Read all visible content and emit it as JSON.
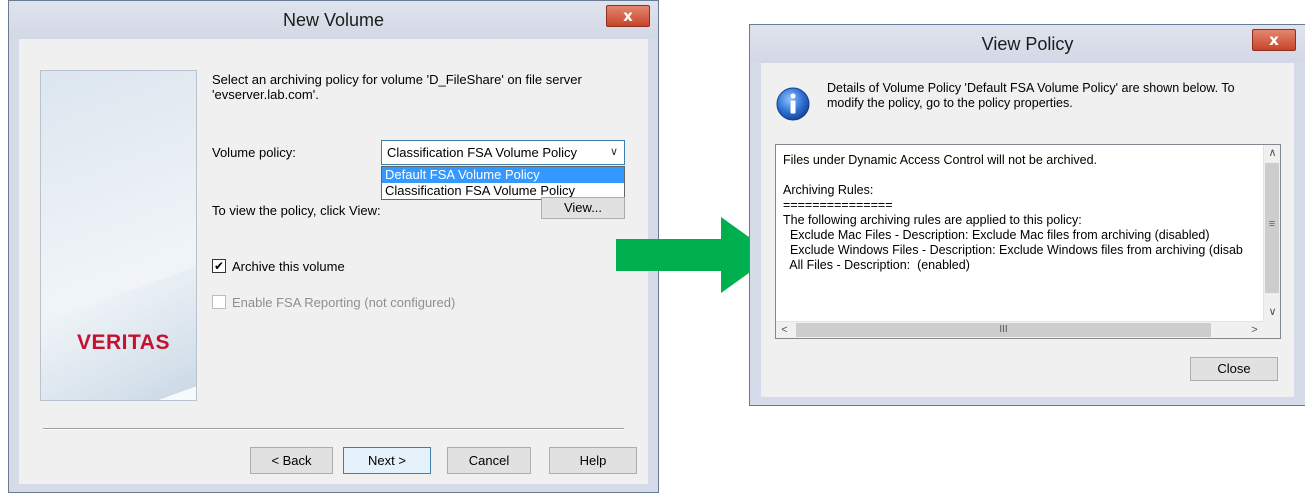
{
  "new_volume": {
    "title": "New Volume",
    "close_label": "x",
    "brand": "VERITAS",
    "intro_line1": "Select an archiving policy for volume 'D_FileShare' on file server",
    "intro_line2": "'evserver.lab.com'.",
    "volume_policy_label": "Volume policy:",
    "volume_policy_value": "Classification FSA Volume Policy",
    "dropdown_options": [
      "Default FSA Volume Policy",
      "Classification FSA Volume Policy"
    ],
    "view_hint": "To view the policy, click View:",
    "view_button": "View...",
    "archive_checkbox_label": "Archive this volume",
    "archive_checked": true,
    "reporting_checkbox_label": "Enable FSA Reporting (not configured)",
    "buttons": {
      "back": "< Back",
      "next": "Next >",
      "cancel": "Cancel",
      "help": "Help"
    }
  },
  "arrow_color": "#00b04f",
  "view_policy": {
    "title": "View Policy",
    "close_label": "x",
    "info_line1": "Details of Volume Policy 'Default FSA Volume Policy' are shown below. To",
    "info_line2": "modify the policy, go to the policy properties.",
    "details_lines": [
      "Files under Dynamic Access Control will not be archived.",
      "",
      "Archiving Rules:",
      "===============",
      "The following archiving rules are applied to this policy:",
      "  Exclude Mac Files - Description: Exclude Mac files from archiving (disabled)",
      "  Exclude Windows Files - Description: Exclude Windows files from archiving (disab",
      "  All Files - Description:  (enabled)"
    ],
    "close_button": "Close",
    "hscroll_grip": "III"
  }
}
